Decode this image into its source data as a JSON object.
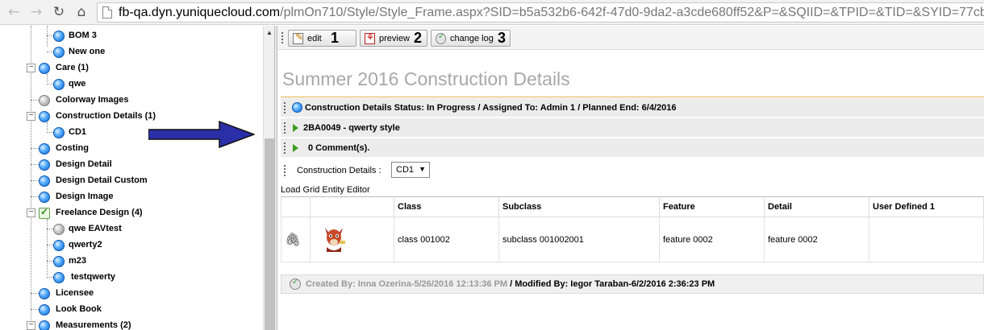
{
  "browser": {
    "url_host": "fb-qa.dyn.yuniquecloud.com",
    "url_path": "/plmOn710/Style/Style_Frame.aspx?SID=b5a532b6-642f-47d0-9da2-a3cde680ff52&P=&SQIID=&TPID=&TID=&SYID=77cb"
  },
  "tree": {
    "items": [
      {
        "label": "BOM 3",
        "icon": "blue"
      },
      {
        "label": "New one",
        "icon": "blue"
      },
      {
        "label": "Care (1)",
        "icon": "blue"
      },
      {
        "label": "qwe",
        "icon": "blue"
      },
      {
        "label": "Colorway Images",
        "icon": "gray"
      },
      {
        "label": "Construction Details (1)",
        "icon": "blue"
      },
      {
        "label": "CD1",
        "icon": "blue"
      },
      {
        "label": "Costing",
        "icon": "blue"
      },
      {
        "label": "Design Detail",
        "icon": "blue"
      },
      {
        "label": "Design Detail Custom",
        "icon": "blue"
      },
      {
        "label": "Design Image",
        "icon": "blue"
      },
      {
        "label": "Freelance Design (4)",
        "icon": "check"
      },
      {
        "label": "qwe EAVtest",
        "icon": "gray"
      },
      {
        "label": "qwerty2",
        "icon": "blue"
      },
      {
        "label": "m23",
        "icon": "blue"
      },
      {
        "label": "testqwerty",
        "icon": "blue"
      },
      {
        "label": "Licensee",
        "icon": "blue"
      },
      {
        "label": "Look Book",
        "icon": "blue"
      },
      {
        "label": "Measurements (2)",
        "icon": "blue"
      }
    ]
  },
  "toolbar": {
    "edit_label": "edit",
    "edit_num": "1",
    "preview_label": "preview",
    "preview_num": "2",
    "changelog_label": "change log",
    "changelog_num": "3"
  },
  "page_title": "Summer 2016 Construction Details",
  "sections": {
    "status": "Construction Details  Status: In Progress / Assigned To: Admin 1 / Planned End: 6/4/2016",
    "style": "2BA0049 - qwerty style",
    "comments": "0 Comment(s)."
  },
  "filter": {
    "label": "Construction Details  :",
    "value": "CD1"
  },
  "grid": {
    "load_link": "Load Grid Entity Editor",
    "headers": [
      "",
      "",
      "Class",
      "Subclass",
      "Feature",
      "Detail",
      "User Defined 1"
    ],
    "row": {
      "class": "class 001002",
      "subclass": "subclass 001002001",
      "feature": "feature 0002",
      "detail": "feature 0002",
      "user_defined_1": ""
    }
  },
  "audit": {
    "created": "Created By: Inna Ozerina-5/26/2016 12:13:36 PM",
    "modified": " / Modified By: Iegor Taraban-6/2/2016 2:36:23 PM"
  },
  "colors": {
    "globe_blue": "#0a66d4",
    "arrow_blue": "#2a2fa8",
    "title_gray": "#a8a8a8",
    "accent_orange": "#e2b04a"
  }
}
